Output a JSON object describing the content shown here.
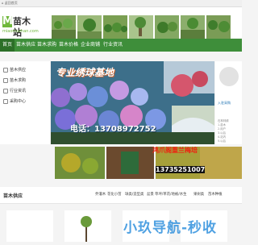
{
  "topbar": {
    "home_label": "⌂ 返回首页",
    "right_text": ""
  },
  "logo": {
    "mark": "M",
    "name": "苗木站",
    "domain": "miaomuzhan.com"
  },
  "nav": {
    "items": [
      "首页",
      "苗木供应",
      "苗木求购",
      "苗木价格",
      "企业商铺",
      "行业资讯"
    ]
  },
  "sidebar": {
    "items": [
      "苗木供应",
      "苗木求购",
      "行业资讯",
      "采购中心"
    ]
  },
  "banner": {
    "title": "专业绣球基地",
    "phone": "电话：13708972752"
  },
  "right_panel": {
    "link": "入驻采购",
    "lines": [
      "石林林绣",
      "1.苗木",
      "2.用户",
      "3.以后",
      "4.站内",
      "5.以后",
      "6.苗木"
    ]
  },
  "ads": {
    "text1": "鸿爪阁重兰梅培",
    "phone": "13735251007"
  },
  "supply": {
    "title": "苗木供应",
    "categories": [
      "乔灌木",
      "花化小苗",
      "球类/造型类",
      "盆景",
      "草坪/草花/地被/水生",
      "果树类",
      "苗木种植"
    ]
  },
  "watermark": "小玖导航-秒收",
  "colors": {
    "nav": "#3e8e3a",
    "nav_active": "#2c6f28",
    "logo_green": "#6fb73b",
    "banner_phone": "#ffffff"
  }
}
